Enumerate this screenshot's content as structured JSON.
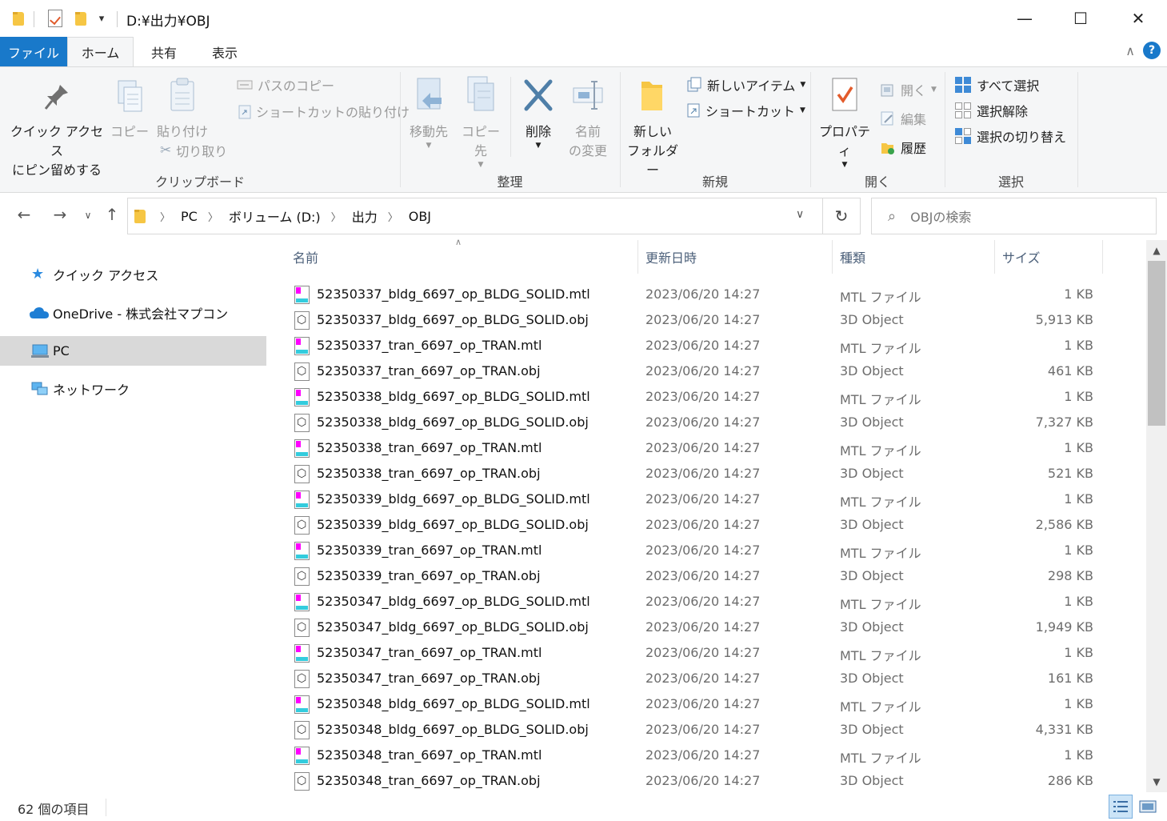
{
  "window": {
    "title": "D:¥出力¥OBJ",
    "minimize": "—",
    "maximize": "☐",
    "close": "✕",
    "qa_dropdown": "▾"
  },
  "tabs": {
    "file": "ファイル",
    "home": "ホーム",
    "share": "共有",
    "view": "表示",
    "collapse": "∧",
    "help": "?"
  },
  "ribbon": {
    "clipboard": {
      "pin_line1": "クイック アクセス",
      "pin_line2": "にピン留めする",
      "copy": "コピー",
      "paste": "貼り付け",
      "copy_path": "パスのコピー",
      "paste_shortcut": "ショートカットの貼り付け",
      "cut": "切り取り",
      "label": "クリップボード"
    },
    "organize": {
      "move_to": "移動先",
      "copy_to": "コピー先",
      "delete": "削除",
      "rename_line1": "名前",
      "rename_line2": "の変更",
      "label": "整理"
    },
    "new": {
      "new_folder_line1": "新しい",
      "new_folder_line2": "フォルダー",
      "new_item": "新しいアイテム",
      "easy_access": "ショートカット",
      "label": "新規"
    },
    "open": {
      "properties": "プロパティ",
      "open": "開く",
      "edit": "編集",
      "history": "履歴",
      "label": "開く"
    },
    "select": {
      "select_all": "すべて選択",
      "select_none": "選択解除",
      "invert": "選択の切り替え",
      "label": "選択"
    }
  },
  "address": {
    "crumbs": [
      "PC",
      "ボリューム (D:)",
      "出力",
      "OBJ"
    ],
    "search_placeholder": "OBJの検索"
  },
  "nav": {
    "quick_access": "クイック アクセス",
    "onedrive": "OneDrive - 株式会社マプコン",
    "pc": "PC",
    "network": "ネットワーク"
  },
  "columns": {
    "name": "名前",
    "date": "更新日時",
    "type": "種類",
    "size": "サイズ"
  },
  "files": [
    {
      "name": "52350337_bldg_6697_op_BLDG_SOLID.mtl",
      "date": "2023/06/20 14:27",
      "type": "MTL ファイル",
      "size": "1 KB",
      "icon": "mtl"
    },
    {
      "name": "52350337_bldg_6697_op_BLDG_SOLID.obj",
      "date": "2023/06/20 14:27",
      "type": "3D Object",
      "size": "5,913 KB",
      "icon": "obj"
    },
    {
      "name": "52350337_tran_6697_op_TRAN.mtl",
      "date": "2023/06/20 14:27",
      "type": "MTL ファイル",
      "size": "1 KB",
      "icon": "mtl"
    },
    {
      "name": "52350337_tran_6697_op_TRAN.obj",
      "date": "2023/06/20 14:27",
      "type": "3D Object",
      "size": "461 KB",
      "icon": "obj"
    },
    {
      "name": "52350338_bldg_6697_op_BLDG_SOLID.mtl",
      "date": "2023/06/20 14:27",
      "type": "MTL ファイル",
      "size": "1 KB",
      "icon": "mtl"
    },
    {
      "name": "52350338_bldg_6697_op_BLDG_SOLID.obj",
      "date": "2023/06/20 14:27",
      "type": "3D Object",
      "size": "7,327 KB",
      "icon": "obj"
    },
    {
      "name": "52350338_tran_6697_op_TRAN.mtl",
      "date": "2023/06/20 14:27",
      "type": "MTL ファイル",
      "size": "1 KB",
      "icon": "mtl"
    },
    {
      "name": "52350338_tran_6697_op_TRAN.obj",
      "date": "2023/06/20 14:27",
      "type": "3D Object",
      "size": "521 KB",
      "icon": "obj"
    },
    {
      "name": "52350339_bldg_6697_op_BLDG_SOLID.mtl",
      "date": "2023/06/20 14:27",
      "type": "MTL ファイル",
      "size": "1 KB",
      "icon": "mtl"
    },
    {
      "name": "52350339_bldg_6697_op_BLDG_SOLID.obj",
      "date": "2023/06/20 14:27",
      "type": "3D Object",
      "size": "2,586 KB",
      "icon": "obj"
    },
    {
      "name": "52350339_tran_6697_op_TRAN.mtl",
      "date": "2023/06/20 14:27",
      "type": "MTL ファイル",
      "size": "1 KB",
      "icon": "mtl"
    },
    {
      "name": "52350339_tran_6697_op_TRAN.obj",
      "date": "2023/06/20 14:27",
      "type": "3D Object",
      "size": "298 KB",
      "icon": "obj"
    },
    {
      "name": "52350347_bldg_6697_op_BLDG_SOLID.mtl",
      "date": "2023/06/20 14:27",
      "type": "MTL ファイル",
      "size": "1 KB",
      "icon": "mtl"
    },
    {
      "name": "52350347_bldg_6697_op_BLDG_SOLID.obj",
      "date": "2023/06/20 14:27",
      "type": "3D Object",
      "size": "1,949 KB",
      "icon": "obj"
    },
    {
      "name": "52350347_tran_6697_op_TRAN.mtl",
      "date": "2023/06/20 14:27",
      "type": "MTL ファイル",
      "size": "1 KB",
      "icon": "mtl"
    },
    {
      "name": "52350347_tran_6697_op_TRAN.obj",
      "date": "2023/06/20 14:27",
      "type": "3D Object",
      "size": "161 KB",
      "icon": "obj"
    },
    {
      "name": "52350348_bldg_6697_op_BLDG_SOLID.mtl",
      "date": "2023/06/20 14:27",
      "type": "MTL ファイル",
      "size": "1 KB",
      "icon": "mtl"
    },
    {
      "name": "52350348_bldg_6697_op_BLDG_SOLID.obj",
      "date": "2023/06/20 14:27",
      "type": "3D Object",
      "size": "4,331 KB",
      "icon": "obj"
    },
    {
      "name": "52350348_tran_6697_op_TRAN.mtl",
      "date": "2023/06/20 14:27",
      "type": "MTL ファイル",
      "size": "1 KB",
      "icon": "mtl"
    },
    {
      "name": "52350348_tran_6697_op_TRAN.obj",
      "date": "2023/06/20 14:27",
      "type": "3D Object",
      "size": "286 KB",
      "icon": "obj"
    }
  ],
  "status": {
    "item_count": "62 個の項目"
  },
  "colors": {
    "accent": "#1979ca",
    "selected_nav": "#d9d9d9",
    "ribbon_bg": "#f5f6f7",
    "header_text": "#4c607a"
  }
}
